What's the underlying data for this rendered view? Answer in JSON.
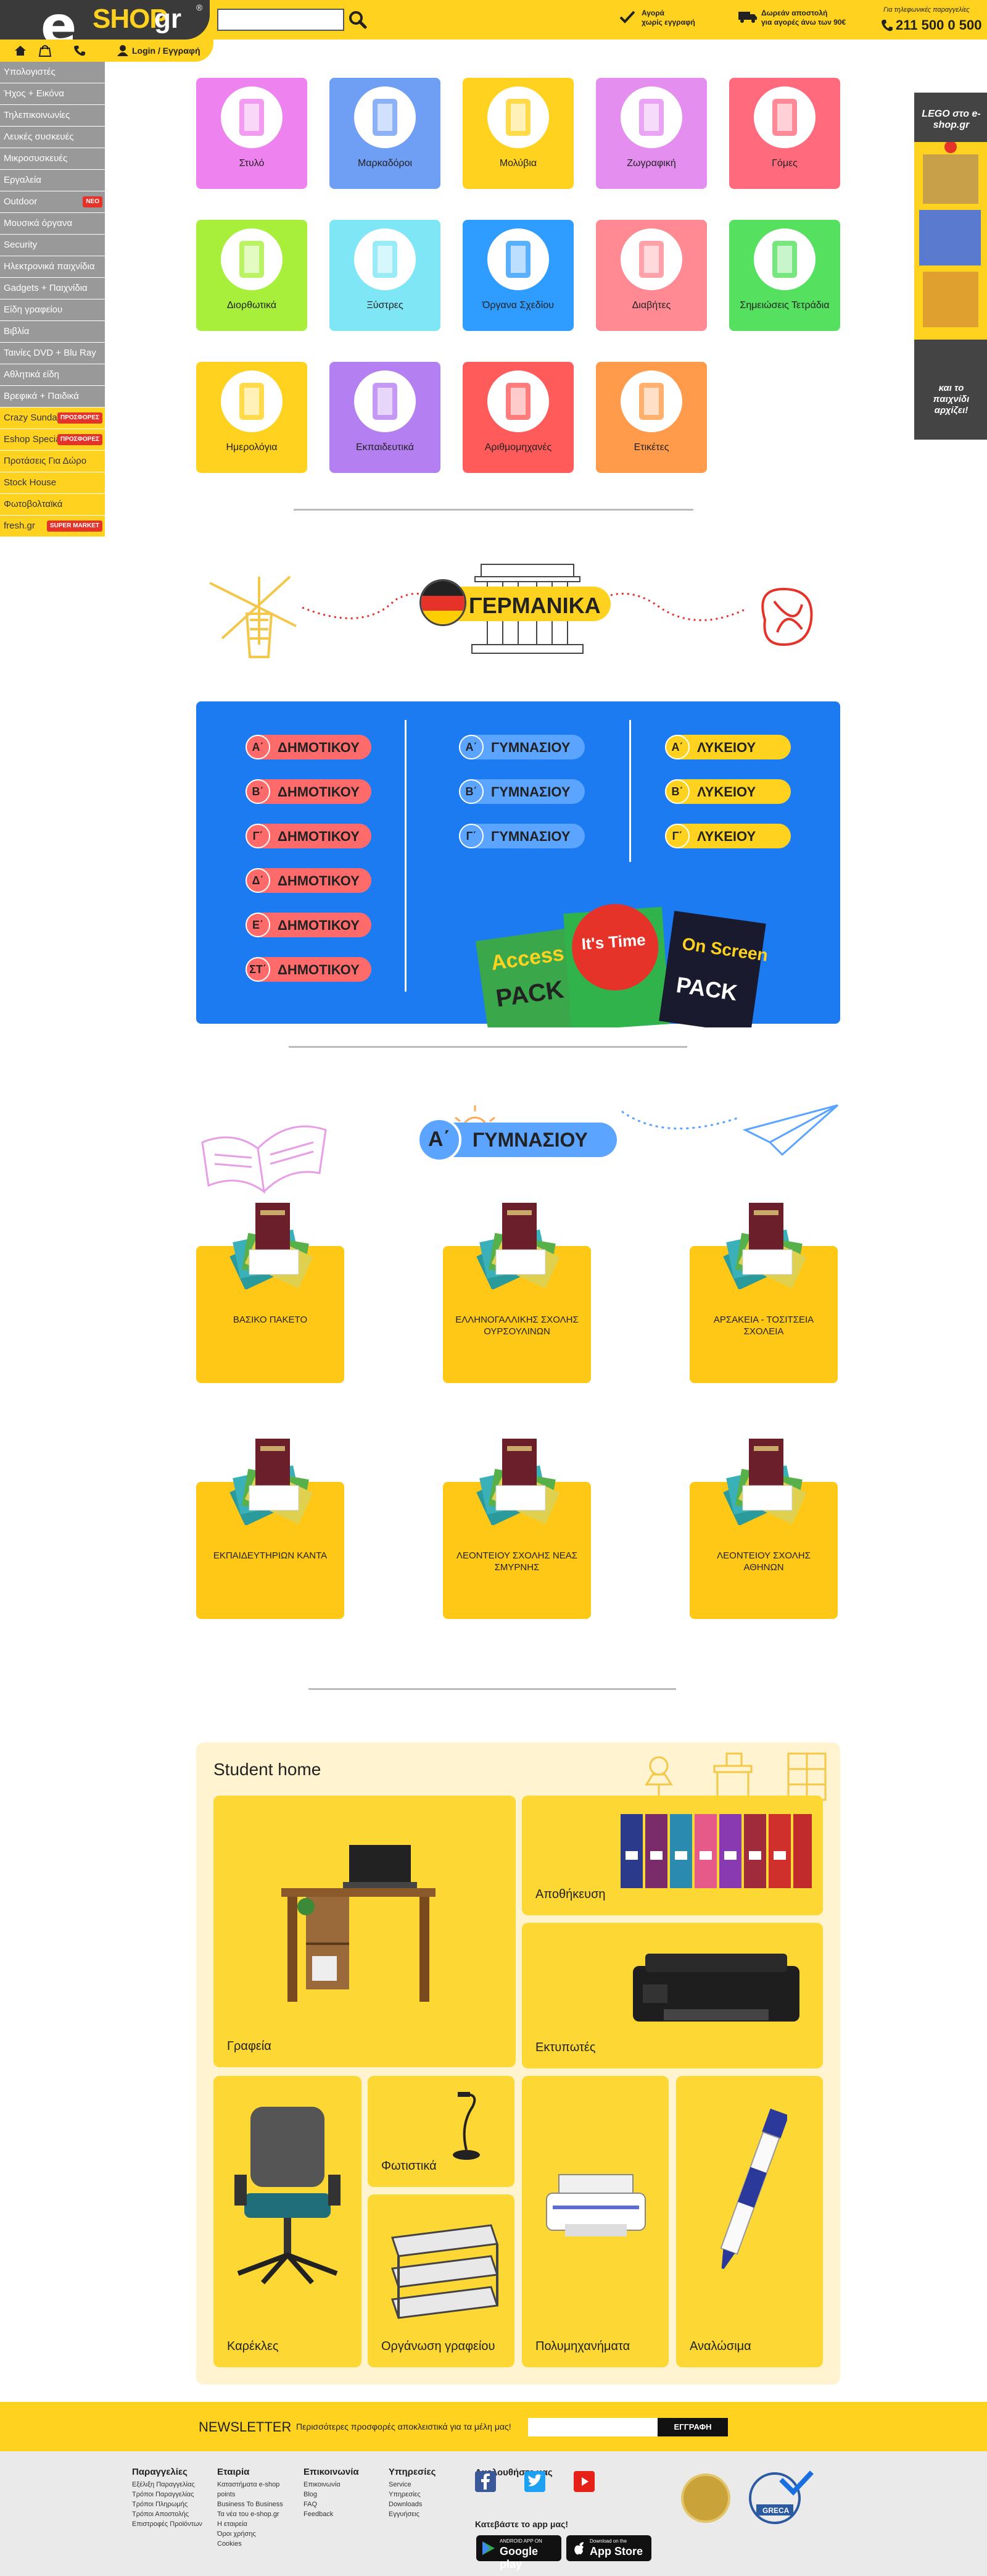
{
  "header": {
    "logo_e": "e",
    "logo_shop": "SHOP",
    "logo_gr": "gr",
    "logo_reg": "®",
    "search_placeholder": "",
    "info1_line1": "Αγορά",
    "info1_line2": "χωρίς εγγραφή",
    "info2_line1": "Δωρεάν αποστολή",
    "info2_line2": "για αγορές άνω των 90€",
    "phone_label": "Για τηλεφωνικές παραγγελίες",
    "phone_number": "211 500 0 500",
    "login": "Login / Εγγραφή"
  },
  "sidebar": {
    "items": [
      {
        "label": "Υπολογιστές",
        "badge": ""
      },
      {
        "label": "Ήχος + Εικόνα",
        "badge": ""
      },
      {
        "label": "Τηλεπικοινωνίες",
        "badge": ""
      },
      {
        "label": "Λευκές συσκευές",
        "badge": ""
      },
      {
        "label": "Μικροσυσκευές",
        "badge": ""
      },
      {
        "label": "Εργαλεία",
        "badge": ""
      },
      {
        "label": "Outdoor",
        "badge": "NEO"
      },
      {
        "label": "Μουσικά όργανα",
        "badge": ""
      },
      {
        "label": "Security",
        "badge": ""
      },
      {
        "label": "Ηλεκτρονικά παιχνίδια",
        "badge": ""
      },
      {
        "label": "Gadgets + Παιχνίδια",
        "badge": ""
      },
      {
        "label": "Είδη γραφείου",
        "badge": ""
      },
      {
        "label": "Βιβλία",
        "badge": ""
      },
      {
        "label": "Ταινίες DVD + Blu Ray",
        "badge": ""
      },
      {
        "label": "Αθλητικά είδη",
        "badge": ""
      },
      {
        "label": "Βρεφικά + Παιδικά",
        "badge": ""
      }
    ],
    "yellow_items": [
      {
        "label": "Crazy Sundays",
        "badge": "ΠΡΟΣΦΟΡΕΣ"
      },
      {
        "label": "Eshop Specials",
        "badge": "ΠΡΟΣΦΟΡΕΣ"
      },
      {
        "label": "Προτάσεις Για Δώρο",
        "badge": ""
      },
      {
        "label": "Stock House",
        "badge": ""
      },
      {
        "label": "Φωτοβολταϊκά",
        "badge": ""
      },
      {
        "label": "fresh.gr",
        "badge": "SUPER MARKET"
      }
    ]
  },
  "categories": [
    {
      "label": "Στυλό",
      "color": "#ee82ee"
    },
    {
      "label": "Μαρκαδόροι",
      "color": "#6f9ef5"
    },
    {
      "label": "Μολύβια",
      "color": "#ffd21f"
    },
    {
      "label": "Ζωγραφική",
      "color": "#e48ef0"
    },
    {
      "label": "Γόμες",
      "color": "#ff6b7d"
    },
    {
      "label": "Διορθωτικά",
      "color": "#a7ef3b"
    },
    {
      "label": "Ξύστρες",
      "color": "#7ee6f5"
    },
    {
      "label": "Όργανα Σχεδίου",
      "color": "#2f9cff"
    },
    {
      "label": "Διαβήτες",
      "color": "#ff8a94"
    },
    {
      "label": "Σημειώσεις Τετράδια",
      "color": "#55e05f"
    },
    {
      "label": "Ημερολόγια",
      "color": "#ffd21f"
    },
    {
      "label": "Εκπαιδευτικά",
      "color": "#b47ff0"
    },
    {
      "label": "Αριθμομηχανές",
      "color": "#ff5b5b"
    },
    {
      "label": "Ετικέτες",
      "color": "#ff9b4a"
    }
  ],
  "germany": {
    "title": "ΓΕΡΜΑΝΙΚΑ"
  },
  "grades": {
    "dimotiko": [
      {
        "num": "Α΄",
        "label": "ΔΗΜΟΤΙΚΟΥ"
      },
      {
        "num": "Β΄",
        "label": "ΔΗΜΟΤΙΚΟΥ"
      },
      {
        "num": "Γ΄",
        "label": "ΔΗΜΟΤΙΚΟΥ"
      },
      {
        "num": "Δ΄",
        "label": "ΔΗΜΟΤΙΚΟΥ"
      },
      {
        "num": "Ε΄",
        "label": "ΔΗΜΟΤΙΚΟΥ"
      },
      {
        "num": "ΣΤ΄",
        "label": "ΔΗΜΟΤΙΚΟΥ"
      }
    ],
    "gymnasio": [
      {
        "num": "Α΄",
        "label": "ΓΥΜΝΑΣΙΟΥ"
      },
      {
        "num": "Β΄",
        "label": "ΓΥΜΝΑΣΙΟΥ"
      },
      {
        "num": "Γ΄",
        "label": "ΓΥΜΝΑΣΙΟΥ"
      }
    ],
    "lykeio": [
      {
        "num": "Α΄",
        "label": "ΛΥΚΕΙΟΥ"
      },
      {
        "num": "Β΄",
        "label": "ΛΥΚΕΙΟΥ"
      },
      {
        "num": "Γ΄",
        "label": "ΛΥΚΕΙΟΥ"
      }
    ],
    "book_titles": [
      "Access",
      "It's Time",
      "On Screen"
    ]
  },
  "gymnasio_section": {
    "num": "Α΄",
    "title": "ΓΥΜΝΑΣΙΟΥ",
    "packages": [
      "ΒΑΣΙΚΟ ΠΑΚΕΤΟ",
      "ΕΛΛΗΝΟΓΑΛΛΙΚΗΣ ΣΧΟΛΗΣ ΟΥΡΣΟΥΛΙΝΩΝ",
      "ΑΡΣΑΚΕΙΑ - ΤΟΣΙΤΣΕΙΑ ΣΧΟΛΕΙΑ",
      "ΕΚΠΑΙΔΕΥΤΗΡΙΩΝ ΚΑΝΤΑ",
      "ΛΕΟΝΤΕΙΟΥ ΣΧΟΛΗΣ ΝΕΑΣ ΣΜΥΡΝΗΣ",
      "ΛΕΟΝΤΕΙΟΥ ΣΧΟΛΗΣ ΑΘΗΝΩΝ"
    ]
  },
  "student_home": {
    "title": "Student home",
    "tiles": [
      "Γραφεία",
      "Αποθήκευση",
      "Εκτυπωτές",
      "Καρέκλες",
      "Φωτιστικά",
      "Οργάνωση γραφείου",
      "Πολυμηχανήματα",
      "Αναλώσιμα"
    ]
  },
  "newsletter": {
    "title": "NEWSLETTER",
    "desc": "Περισσότερες προσφορές αποκλειστικά για τα μέλη μας!",
    "button": "ΕΓΓΡΑΦΗ"
  },
  "right_ad": {
    "top": "LEGO στο e-shop.gr",
    "bottom": "και το παιχνίδι αρχίζει!"
  },
  "footer": {
    "col1": {
      "title": "Παραγγελίες",
      "items": [
        "Εξέλιξη Παραγγελίας",
        "Τρόποι Παραγγελίας",
        "Τρόποι Πληρωμής",
        "Τρόποι Αποστολής",
        "Επιστροφές Προϊόντων"
      ]
    },
    "col2": {
      "title": "Εταιρία",
      "items": [
        "Καταστήματα e-shop points",
        "Business To Business",
        "Τα νέα του e-shop.gr",
        "Η εταιρεία",
        "Όροι χρήσης",
        "Cookies"
      ]
    },
    "col3": {
      "title": "Επικοινωνία",
      "items": [
        "Επικοινωνία",
        "Blog",
        "FAQ",
        "Feedback"
      ]
    },
    "col4": {
      "title": "Υπηρεσίες",
      "items": [
        "Service",
        "Υπηρεσίες",
        "Downloads",
        "Εγγυήσεις"
      ]
    },
    "follow_title": "Ακολουθήστε μας",
    "app_title": "Κατεβάστε το app μας!",
    "google_small": "ANDROID APP ON",
    "google_big": "Google play",
    "apple_small": "Download on the",
    "apple_big": "App Store",
    "award_text": "GRECA"
  },
  "colors": {
    "brand_yellow": "#ffd21f",
    "dark": "#3a3a3a",
    "sidebar_gray": "#999999",
    "blue_panel": "#1c7bf0"
  }
}
